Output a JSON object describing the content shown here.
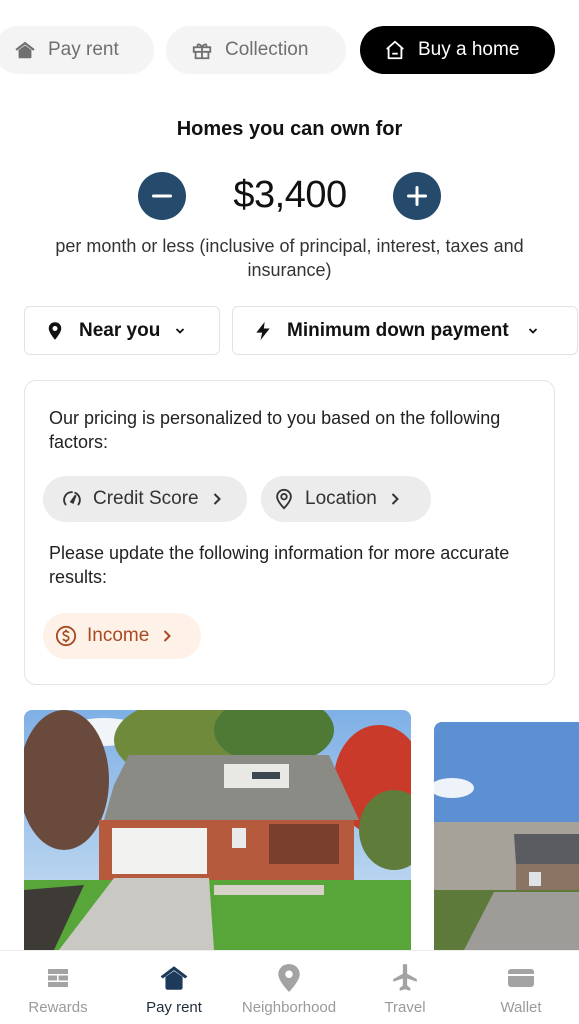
{
  "top_tabs": [
    {
      "label": "Pay rent",
      "icon": "house-filled-icon",
      "active": false
    },
    {
      "label": "Collection",
      "icon": "gift-icon",
      "active": false
    },
    {
      "label": "Buy a home",
      "icon": "house-outline-icon",
      "active": true
    }
  ],
  "affordability": {
    "heading": "Homes you can own for",
    "amount": "$3,400",
    "decrement_icon": "minus-icon",
    "increment_icon": "plus-icon",
    "subtext": "per month or less (inclusive of principal, interest, taxes and insurance)"
  },
  "filters": [
    {
      "label": "Near you",
      "icon": "map-pin-icon"
    },
    {
      "label": "Minimum down payment",
      "icon": "lightning-icon"
    }
  ],
  "pricing_card": {
    "intro": "Our pricing is personalized to you based on the following factors:",
    "factors": [
      {
        "label": "Credit Score",
        "icon": "gauge-icon"
      },
      {
        "label": "Location",
        "icon": "location-pin-icon"
      }
    ],
    "update_prompt": "Please update the following information for more accurate results:",
    "updates": [
      {
        "label": "Income",
        "icon": "dollar-circle-icon"
      }
    ],
    "colors": {
      "income_accent": "#a64b22",
      "income_bg": "#fdf1e8"
    }
  },
  "listings": [
    {
      "image": "brick-house-with-garage-photo"
    },
    {
      "image": "house-with-driveway-photo"
    }
  ],
  "bottom_nav": [
    {
      "label": "Rewards",
      "icon": "bricks-icon",
      "active": false
    },
    {
      "label": "Pay rent",
      "icon": "house-filled-icon",
      "active": true
    },
    {
      "label": "Neighborhood",
      "icon": "map-pin-icon",
      "active": false
    },
    {
      "label": "Travel",
      "icon": "airplane-icon",
      "active": false
    },
    {
      "label": "Wallet",
      "icon": "wallet-card-icon",
      "active": false
    }
  ],
  "colors": {
    "primary": "#254a6b",
    "nav_active": "#1e3a5a",
    "nav_inactive": "#a3a3a3"
  }
}
